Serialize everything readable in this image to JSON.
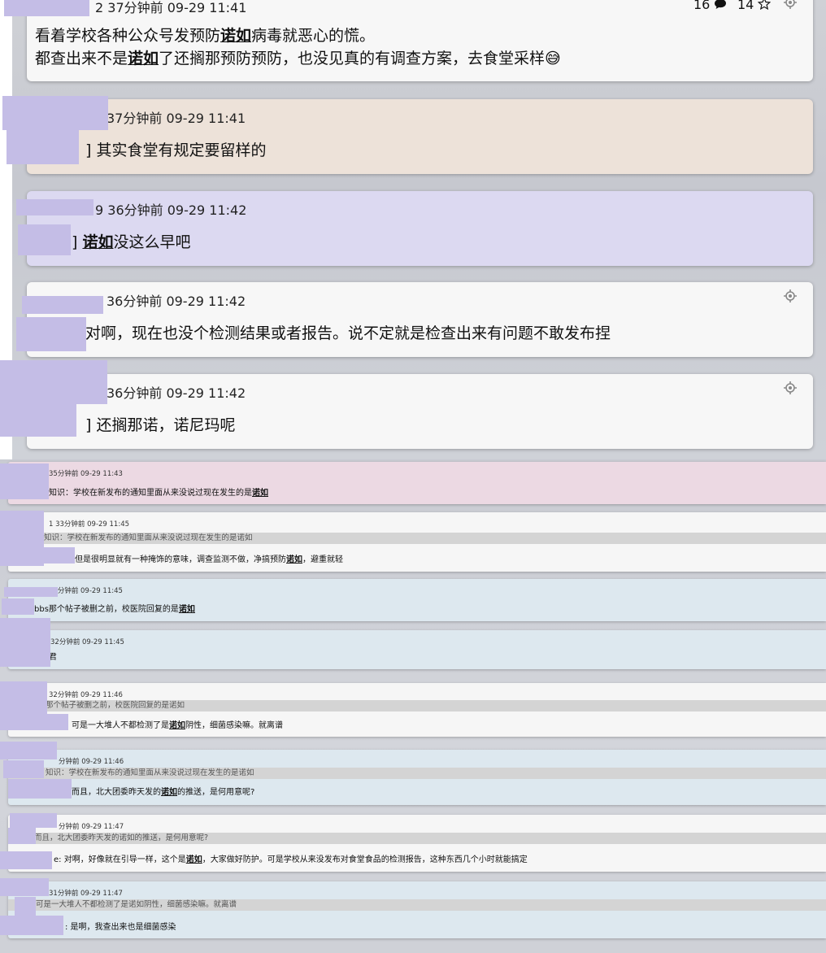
{
  "post": {
    "meta": "2 37分钟前 09-29 11:41",
    "comment_count": "16",
    "star_count": "14",
    "line1_pre": "看着学校各种公众号发预防",
    "line1_kw": "诺如",
    "line1_post": "病毒就恶心的慌。",
    "line2_pre": "都查出来不是",
    "line2_kw": "诺如",
    "line2_post": "了还搁那预防预防，也没见真的有调查方案，去食堂采样😅"
  },
  "replies": [
    {
      "meta": "37分钟前 09-29 11:41",
      "pre": "] 其实食堂有规定要留样的",
      "kw": "",
      "post": ""
    },
    {
      "meta": "9 36分钟前 09-29 11:42",
      "pre": "] ",
      "kw": "诺如",
      "post": "没这么早吧"
    },
    {
      "meta": "36分钟前 09-29 11:42",
      "pre": "对啊，现在也没个检测结果或者报告。说不定就是检查出来有问题不敢发布捏",
      "kw": "",
      "post": ""
    },
    {
      "meta": "36分钟前 09-29 11:42",
      "pre": "] 还搁那诺，诺尼玛呢",
      "kw": "",
      "post": ""
    }
  ],
  "small_replies": [
    {
      "meta": "35分钟前 09-29 11:43",
      "quote": "",
      "pre": "冷知识：学校在新发布的通知里面从来没说过现在发生的是",
      "kw": "诺如",
      "post": ""
    },
    {
      "meta": "1 33分钟前 09-29 11:45",
      "quote": "知识：学校在新发布的通知里面从来没说过现在发生的是诺如",
      "pre": "但是很明显就有一种掩饰的意味，调查监测不做，净搞预防",
      "kw": "诺如",
      "post": "，避重就轻"
    },
    {
      "meta": "33分钟前 09-29 11:45",
      "quote": "",
      "pre": "bbs那个帖子被删之前，校医院回复的是",
      "kw": "诺如",
      "post": ""
    },
    {
      "meta": "32分钟前 09-29 11:45",
      "quote": "",
      "pre": "回D君",
      "kw": "",
      "post": ""
    },
    {
      "meta": "32分钟前 09-29 11:46",
      "quote": "那个帖子被删之前，校医院回复的是诺如",
      "pre": "可是一大堆人不都检测了是",
      "kw": "诺如",
      "post": "阴性，细菌感染嘛。就离谱"
    },
    {
      "meta": "分钟前 09-29 11:46",
      "quote": "知识：学校在新发布的通知里面从来没说过现在发生的是诺如",
      "pre": "而且，北大团委昨天发的",
      "kw": "诺如",
      "post": "的推送，是何用意呢?"
    },
    {
      "meta": "分钟前 09-29 11:47",
      "quote": "而且，北大团委昨天发的诺如的推送，是何用意呢?",
      "pre": "e: 对啊，好像就在引导一样，这个是",
      "kw": "诺如",
      "post": "，大家做好防护。可是学校从来没发布对食堂食品的检测报告，这种东西几个小时就能搞定"
    },
    {
      "meta": "31分钟前 09-29 11:47",
      "quote": "可是一大堆人不都检测了是诺如阴性，细菌感染嘛。就离谱",
      "pre": ": 是啊，我查出来也是细菌感染",
      "kw": "",
      "post": ""
    }
  ]
}
